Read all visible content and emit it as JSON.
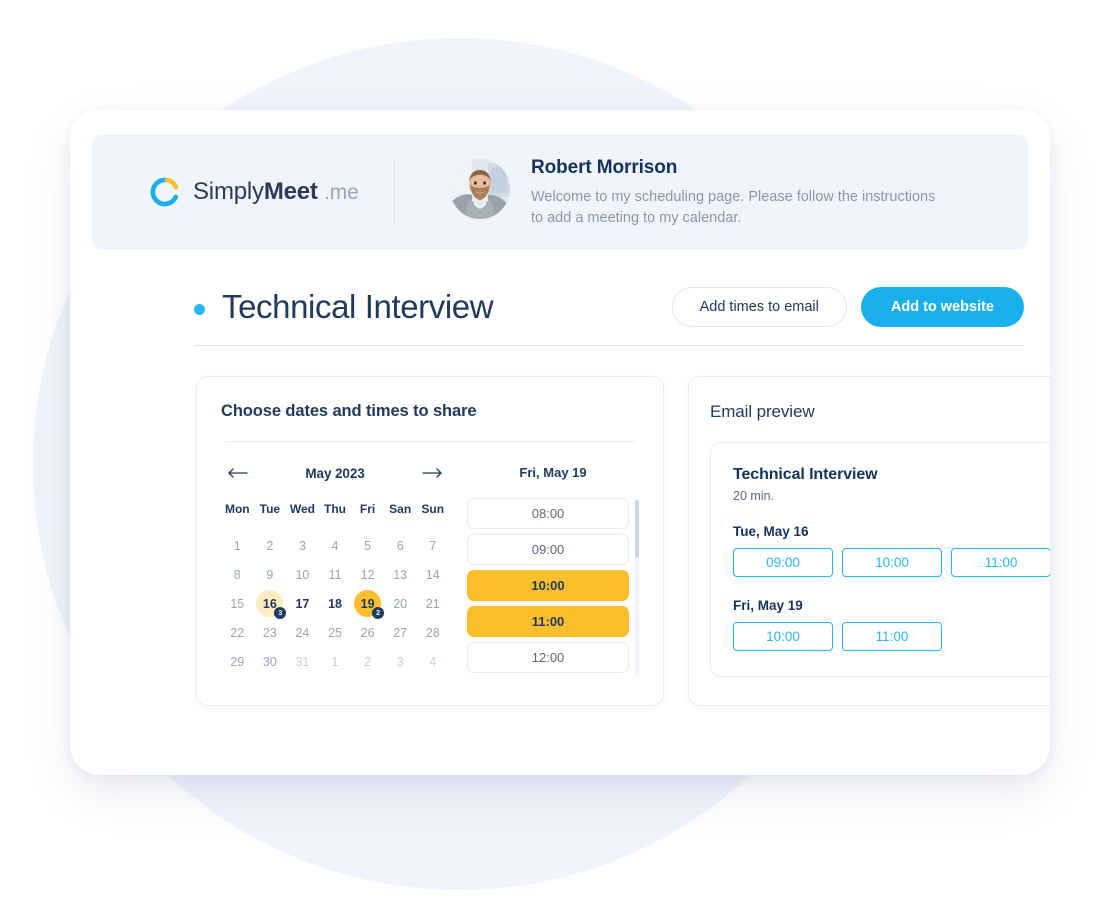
{
  "brand": {
    "simply": "Simply",
    "meet": "Meet",
    "tld": ".me",
    "logo_icon": "simplymeet-ring-icon"
  },
  "host": {
    "name": "Robert Morrison",
    "blurb": "Welcome to my scheduling page. Please follow the instructions to add a meeting to my calendar.",
    "avatar_icon": "avatar-photo"
  },
  "title_row": {
    "title": "Technical Interview",
    "status_dot_color": "#29B6F0",
    "secondary_button": "Add times to email",
    "primary_button": "Add to website",
    "primary_button_color": "#19AFEC"
  },
  "scheduler": {
    "heading": "Choose dates and times to share",
    "calendar": {
      "month_label": "May 2023",
      "prev_icon": "arrow-left-icon",
      "next_icon": "arrow-right-icon",
      "weekdays": [
        "Mon",
        "Tue",
        "Wed",
        "Thu",
        "Fri",
        "San",
        "Sun"
      ],
      "weeks": [
        [
          {
            "n": "1",
            "state": "normal"
          },
          {
            "n": "2",
            "state": "normal"
          },
          {
            "n": "3",
            "state": "normal"
          },
          {
            "n": "4",
            "state": "normal"
          },
          {
            "n": "5",
            "state": "normal"
          },
          {
            "n": "6",
            "state": "normal"
          },
          {
            "n": "7",
            "state": "normal"
          }
        ],
        [
          {
            "n": "8",
            "state": "normal"
          },
          {
            "n": "9",
            "state": "normal"
          },
          {
            "n": "10",
            "state": "normal"
          },
          {
            "n": "11",
            "state": "normal"
          },
          {
            "n": "12",
            "state": "normal"
          },
          {
            "n": "13",
            "state": "normal"
          },
          {
            "n": "14",
            "state": "normal"
          }
        ],
        [
          {
            "n": "15",
            "state": "normal"
          },
          {
            "n": "16",
            "state": "selected-soft",
            "badge": "3"
          },
          {
            "n": "17",
            "state": "available"
          },
          {
            "n": "18",
            "state": "available"
          },
          {
            "n": "19",
            "state": "selected-full",
            "badge": "2"
          },
          {
            "n": "20",
            "state": "normal"
          },
          {
            "n": "21",
            "state": "normal"
          }
        ],
        [
          {
            "n": "22",
            "state": "normal"
          },
          {
            "n": "23",
            "state": "normal"
          },
          {
            "n": "24",
            "state": "normal"
          },
          {
            "n": "25",
            "state": "normal"
          },
          {
            "n": "26",
            "state": "normal"
          },
          {
            "n": "27",
            "state": "normal"
          },
          {
            "n": "28",
            "state": "normal"
          }
        ],
        [
          {
            "n": "29",
            "state": "normal"
          },
          {
            "n": "30",
            "state": "normal"
          },
          {
            "n": "31",
            "state": "muted"
          },
          {
            "n": "1",
            "state": "muted"
          },
          {
            "n": "2",
            "state": "muted"
          },
          {
            "n": "3",
            "state": "muted"
          },
          {
            "n": "4",
            "state": "muted"
          }
        ]
      ]
    },
    "slots": {
      "date_label": "Fri, May 19",
      "items": [
        {
          "time": "08:00",
          "selected": false
        },
        {
          "time": "09:00",
          "selected": false
        },
        {
          "time": "10:00",
          "selected": true
        },
        {
          "time": "11:00",
          "selected": true
        },
        {
          "time": "12:00",
          "selected": false
        }
      ],
      "selected_color": "#FBBE2C"
    }
  },
  "email_preview": {
    "heading": "Email preview",
    "event_title": "Technical Interview",
    "duration": "20 min.",
    "chip_color": "#29B6F0",
    "groups": [
      {
        "date": "Tue, May 16",
        "times": [
          "09:00",
          "10:00",
          "11:00"
        ]
      },
      {
        "date": "Fri, May 19",
        "times": [
          "10:00",
          "11:00"
        ]
      }
    ]
  }
}
